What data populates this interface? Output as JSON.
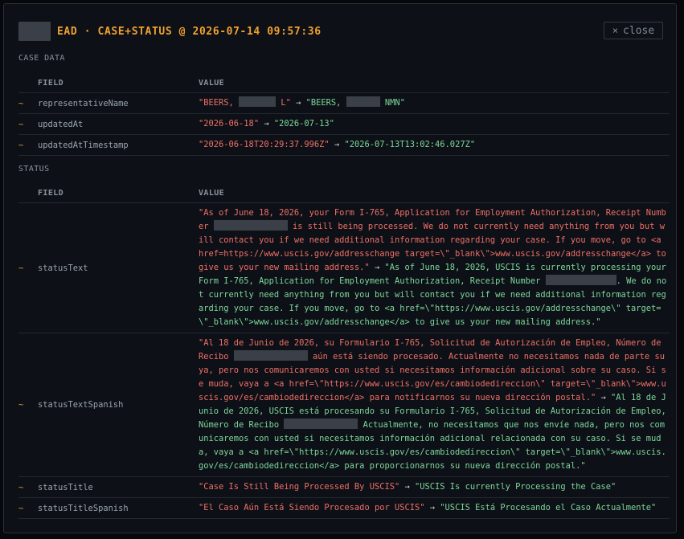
{
  "header": {
    "title": "EAD · CASE+STATUS @ 2026-07-14 09:57:36",
    "close_label": "close",
    "close_icon": "×"
  },
  "case_data": {
    "label": "CASE DATA",
    "col_field": "FIELD",
    "col_value": "VALUE",
    "rows": [
      {
        "mark": "~",
        "field": "representativeName",
        "old_a": "\"BEERS, ",
        "old_b": "L\"",
        "new_a": "\"BEERS, ",
        "new_b": "NMN\""
      },
      {
        "mark": "~",
        "field": "updatedAt",
        "old": "\"2026-06-18\"",
        "new": "\"2026-07-13\""
      },
      {
        "mark": "~",
        "field": "updatedAtTimestamp",
        "old": "\"2026-06-18T20:29:37.996Z\"",
        "new": "\"2026-07-13T13:02:46.027Z\""
      }
    ]
  },
  "status": {
    "label": "STATUS",
    "col_field": "FIELD",
    "col_value": "VALUE",
    "arrow": " → ",
    "rows": [
      {
        "mark": "~",
        "field": "statusText",
        "old_a": "\"As of June 18, 2026, your Form I-765, Application for Employment Authorization, Receipt Number ",
        "old_b": " is still being processed. We do not currently need anything from you but will contact you if we need additional information regarding your case. If you move, go to <a href=https://www.uscis.gov/addresschange target=\\\"_blank\\\">www.uscis.gov/addresschange</a> to give us your new mailing address.\"",
        "new_a": "\"As of June 18, 2026, USCIS is currently processing your Form I-765, Application for Employment Authorization, Receipt Number ",
        "new_b": ". We do not currently need anything from you but will contact you if we need additional information regarding your case. If you move, go to <a href=\\\"https://www.uscis.gov/addresschange\\\" target=\\\"_blank\\\">www.uscis.gov/addresschange</a> to give us your new mailing address.\""
      },
      {
        "mark": "~",
        "field": "statusTextSpanish",
        "old_a": "\"Al 18 de Junio de 2026, su Formulario I-765, Solicitud de Autorización de Empleo, Número de Recibo ",
        "old_b": " aún está siendo procesado. Actualmente no necesitamos nada de parte suya, pero nos comunicaremos con usted si necesitamos información adicional sobre su caso. Si se muda, vaya a <a href=\\\"https://www.uscis.gov/es/cambiodedireccion\\\" target=\\\"_blank\\\">www.uscis.gov/es/cambiodedireccion</a> para notificarnos su nueva dirección postal.\"",
        "new_a": "\"Al 18 de Junio de 2026, USCIS está procesando su Formulario I-765, Solicitud de Autorización de Empleo, Número de Recibo ",
        "new_b": " Actualmente, no necesitamos que nos envíe nada, pero nos comunicaremos con usted si necesitamos información adicional relacionada con su caso. Si se muda, vaya a <a href=\\\"https://www.uscis.gov/es/cambiodedireccion\\\" target=\\\"_blank\\\">www.uscis.gov/es/cambiodedireccion</a> para proporcionarnos su nueva dirección postal.\""
      },
      {
        "mark": "~",
        "field": "statusTitle",
        "old": "\"Case Is Still Being Processed By USCIS\"",
        "new": "\"USCIS Is currently Processing the Case\""
      },
      {
        "mark": "~",
        "field": "statusTitleSpanish",
        "old": "\"El Caso Aún Está Siendo Procesado por USCIS\"",
        "new": "\"USCIS Está Procesando el Caso Actualmente\""
      }
    ]
  },
  "colors": {
    "old": "#ef6e66",
    "new": "#7ed69b",
    "accent": "#f0a030",
    "modified_mark": "#d59a2c"
  }
}
